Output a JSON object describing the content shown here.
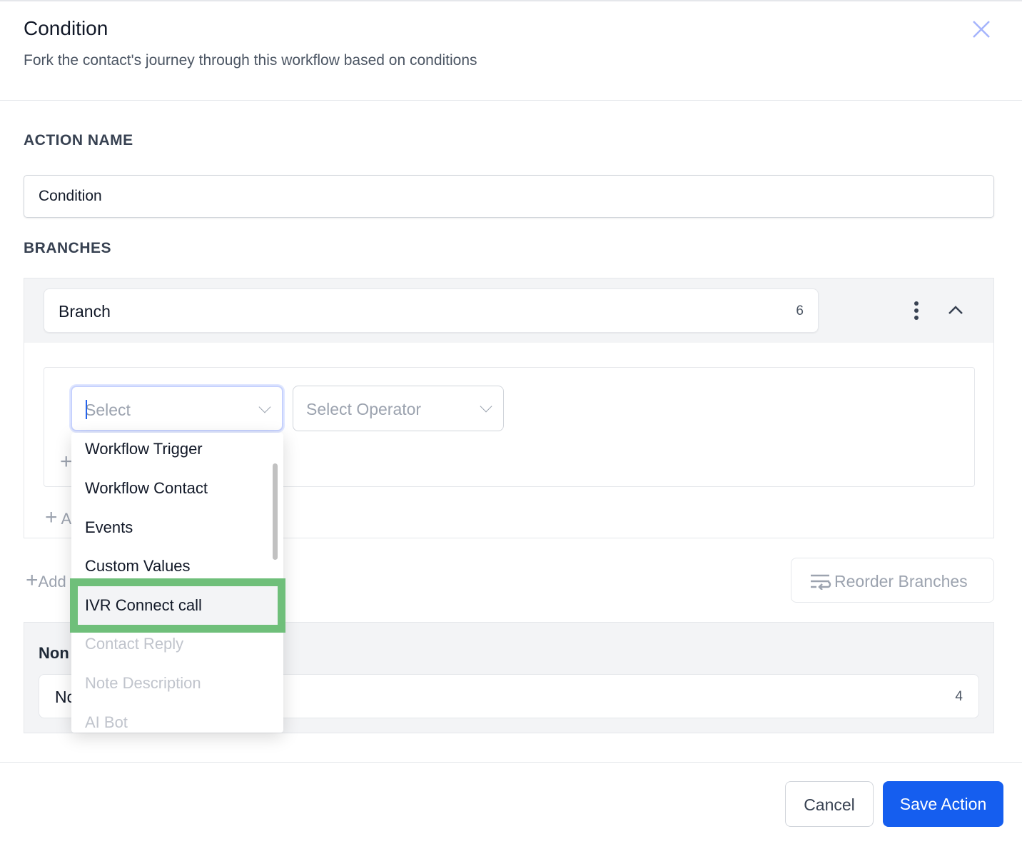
{
  "header": {
    "title": "Condition",
    "subtitle": "Fork the contact's journey through this workflow based on conditions"
  },
  "action_name": {
    "label": "ACTION NAME",
    "value": "Condition"
  },
  "branches": {
    "label": "BRANCHES",
    "branch": {
      "name": "Branch",
      "char_count": "6"
    },
    "condition": {
      "field_placeholder": "Select",
      "operator_placeholder": "Select Operator"
    },
    "add_condition_fragment": "A",
    "add_branch_fragment": "Add",
    "reorder_label": "Reorder Branches"
  },
  "none_branch": {
    "label_fragment": "Non",
    "value_fragment": "No",
    "char_count": "4"
  },
  "dropdown": {
    "options": [
      {
        "label": "Workflow Trigger",
        "disabled": false
      },
      {
        "label": "Workflow Contact",
        "disabled": false
      },
      {
        "label": "Events",
        "disabled": false
      },
      {
        "label": "Custom Values",
        "disabled": false
      },
      {
        "label": "IVR Connect call",
        "disabled": false,
        "highlighted": true
      },
      {
        "label": "Contact Reply",
        "disabled": true
      },
      {
        "label": "Note Description",
        "disabled": true
      },
      {
        "label": "AI Bot",
        "disabled": true
      }
    ]
  },
  "footer": {
    "cancel": "Cancel",
    "save": "Save Action"
  },
  "colors": {
    "primary": "#155eef",
    "highlight": "#6fbf7a"
  }
}
